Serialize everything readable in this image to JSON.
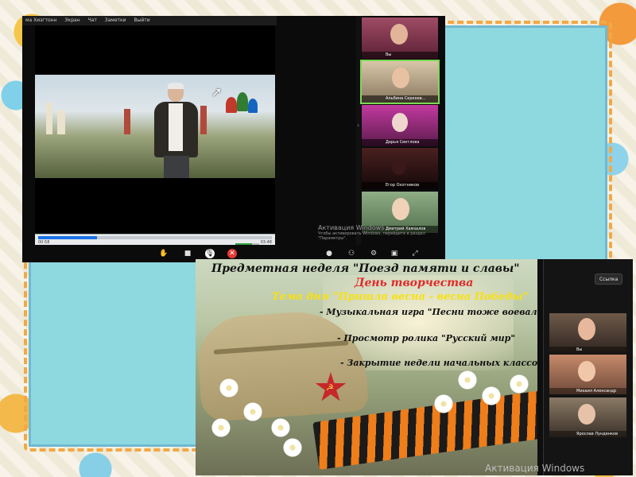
{
  "top_window": {
    "title_items": [
      "ма Хизгтонн",
      "Экран",
      "Чат",
      "Заметки",
      "Выйти"
    ],
    "media": {
      "time_current": "00:58",
      "time_total": "03:48",
      "progress": 0.25,
      "volume": 0.7
    },
    "participants": [
      {
        "name": "Вы"
      },
      {
        "name": "Альбина Серкеев..."
      },
      {
        "name": "Дарья Светлова"
      },
      {
        "name": "Егор Охотников"
      },
      {
        "name": "Дмитрий Хамзалов"
      }
    ],
    "watermark": {
      "line1": "Активация Windows",
      "line2": "Чтобы активировать Windows, перейдите в раздел \"Параметры\"."
    },
    "toolbar_icons": [
      "hand-icon",
      "camera-icon",
      "mic-muted-icon",
      "end-call-icon",
      "chat-icon",
      "participants-icon",
      "settings-icon",
      "share-icon",
      "expand-icon"
    ]
  },
  "bottom_window": {
    "slide": {
      "title": "Предметная неделя \"Поезд памяти и славы\"",
      "day": "День творчества",
      "theme": "Тема дня \"Пришла весна - весна Победы\"",
      "items": [
        "- Музыкальная игра \"Песни тоже воевали\"",
        "- Просмотр ролика \"Русский мир\"",
        "- Закрытие недели начальных классов"
      ]
    },
    "link_button": "Ссылка",
    "participants": [
      {
        "name": "Вы"
      },
      {
        "name": "Михаил Александр"
      },
      {
        "name": "Ярослав Лунденков"
      }
    ],
    "watermark": "Активация Windows"
  }
}
